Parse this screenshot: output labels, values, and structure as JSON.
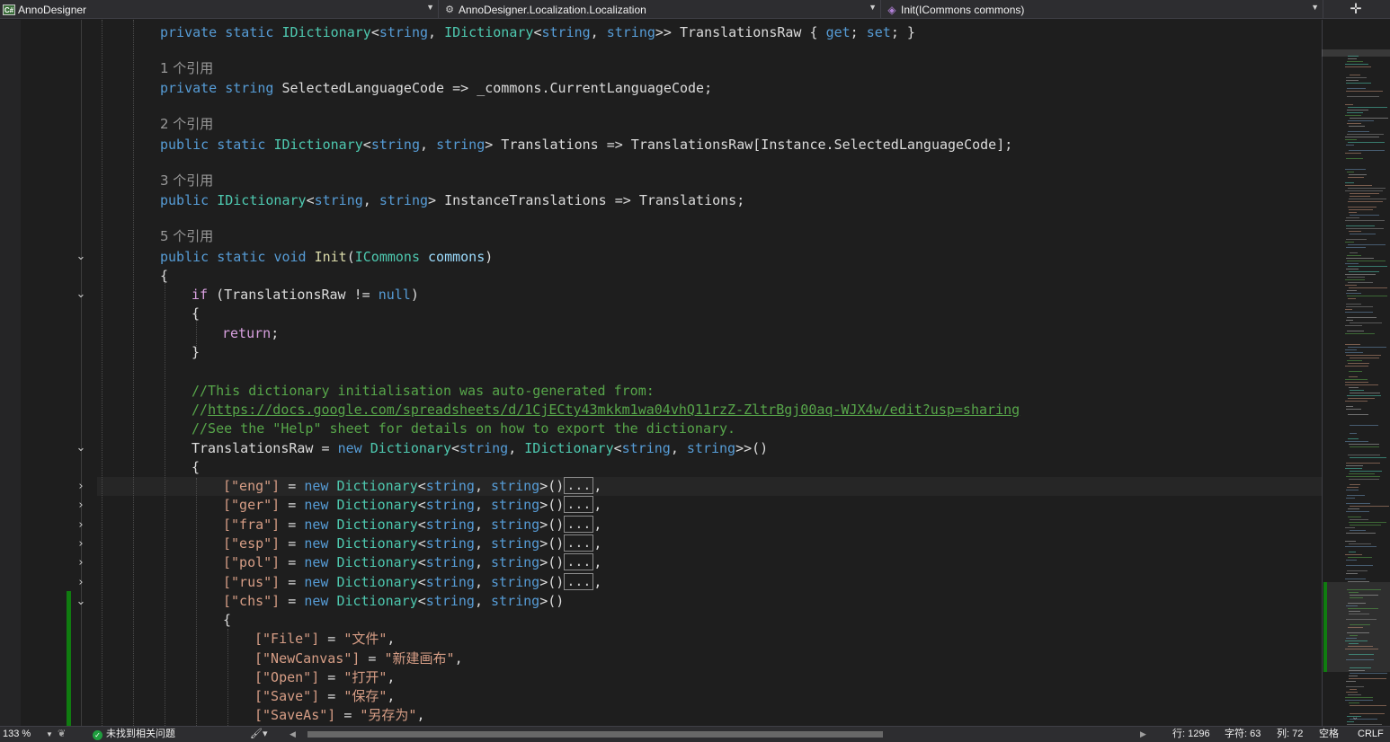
{
  "navbar": {
    "project": "AnnoDesigner",
    "class_name": "AnnoDesigner.Localization.Localization",
    "member": "Init(ICommons commons)",
    "project_icon": "csharp-project-icon",
    "class_icon": "class-icon",
    "member_icon": "method-cube-icon",
    "split_icon": "split-window-icon"
  },
  "code": {
    "line1": {
      "k1": "private",
      "k2": "static",
      "t1": "IDictionary",
      "p1": "<",
      "k3": "string",
      "p2": ", ",
      "t2": "IDictionary",
      "p3": "<",
      "k4": "string",
      "p4": ", ",
      "k5": "string",
      "p5": ">> TranslationsRaw { ",
      "k6": "get",
      "p6": "; ",
      "k7": "set",
      "p7": "; }"
    },
    "lens1": "1 个引用",
    "line2": {
      "k1": "private",
      "k2": "string",
      "p1": " SelectedLanguageCode => _commons.CurrentLanguageCode;"
    },
    "lens2": "2 个引用",
    "line3": {
      "k1": "public",
      "k2": "static",
      "t1": "IDictionary",
      "p1": "<",
      "k3": "string",
      "p2": ", ",
      "k4": "string",
      "p3": "> Translations => TranslationsRaw[Instance.SelectedLanguageCode];"
    },
    "lens3": "3 个引用",
    "line4": {
      "k1": "public",
      "t1": "IDictionary",
      "p1": "<",
      "k2": "string",
      "p2": ", ",
      "k3": "string",
      "p3": "> InstanceTranslations => Translations;"
    },
    "lens4": "5 个引用",
    "line5": {
      "k1": "public",
      "k2": "static",
      "k3": "void",
      "m1": "Init",
      "p1": "(",
      "t1": "ICommons",
      "pa": "commons",
      "p2": ")"
    },
    "brace_open": "{",
    "brace_close": "}",
    "if_line": {
      "k1": "if",
      "p1": " (TranslationsRaw != ",
      "k2": "null",
      "p2": ")"
    },
    "return_line": {
      "k1": "return",
      "p1": ";"
    },
    "comment1": "//This dictionary initialisation was auto-generated from:",
    "comment2_prefix": "//",
    "comment2_link": "https://docs.google.com/spreadsheets/d/1CjECty43mkkm1wa04vhQ11rzZ-ZltrBgj00aq-WJX4w/edit?usp=sharing",
    "comment3": "//See the \"Help\" sheet for details on how to export the dictionary.",
    "assign_line": {
      "p1": "TranslationsRaw = ",
      "k1": "new",
      "t1": "Dictionary",
      "p2": "<",
      "k2": "string",
      "p3": ", ",
      "t2": "IDictionary",
      "p4": "<",
      "k3": "string",
      "p5": ", ",
      "k4": "string",
      "p6": ">>()"
    },
    "languages": [
      {
        "key": "[\"eng\"]",
        "collapsed": "..."
      },
      {
        "key": "[\"ger\"]",
        "collapsed": "..."
      },
      {
        "key": "[\"fra\"]",
        "collapsed": "..."
      },
      {
        "key": "[\"esp\"]",
        "collapsed": "..."
      },
      {
        "key": "[\"pol\"]",
        "collapsed": "..."
      },
      {
        "key": "[\"rus\"]",
        "collapsed": "..."
      }
    ],
    "lang_eq": " = ",
    "lang_new": "new",
    "lang_type": "Dictionary",
    "lang_lt": "<",
    "lang_string": "string",
    "lang_comma": ", ",
    "lang_gt_call": ">()",
    "lang_trailing": ",",
    "chs_key": "[\"chs\"]",
    "chs_entries": [
      {
        "key": "[\"File\"]",
        "eq": " = ",
        "value": "\"文件\"",
        "end": ","
      },
      {
        "key": "[\"NewCanvas\"]",
        "eq": " = ",
        "value": "\"新建画布\"",
        "end": ","
      },
      {
        "key": "[\"Open\"]",
        "eq": " = ",
        "value": "\"打开\"",
        "end": ","
      },
      {
        "key": "[\"Save\"]",
        "eq": " = ",
        "value": "\"保存\"",
        "end": ","
      },
      {
        "key": "[\"SaveAs\"]",
        "eq": " = ",
        "value": "\"另存为\"",
        "end": ","
      }
    ]
  },
  "statusbar": {
    "zoom": "133 %",
    "issues": "未找到相关问题",
    "line": "行: 1296",
    "char": "字符: 63",
    "col": "列: 72",
    "whitespace": "空格",
    "eol": "CRLF"
  },
  "colors": {
    "keyword": "#569cd6",
    "type": "#4ec9b0",
    "string": "#d69d85",
    "comment": "#57a64a",
    "change_bar": "#107c10"
  }
}
